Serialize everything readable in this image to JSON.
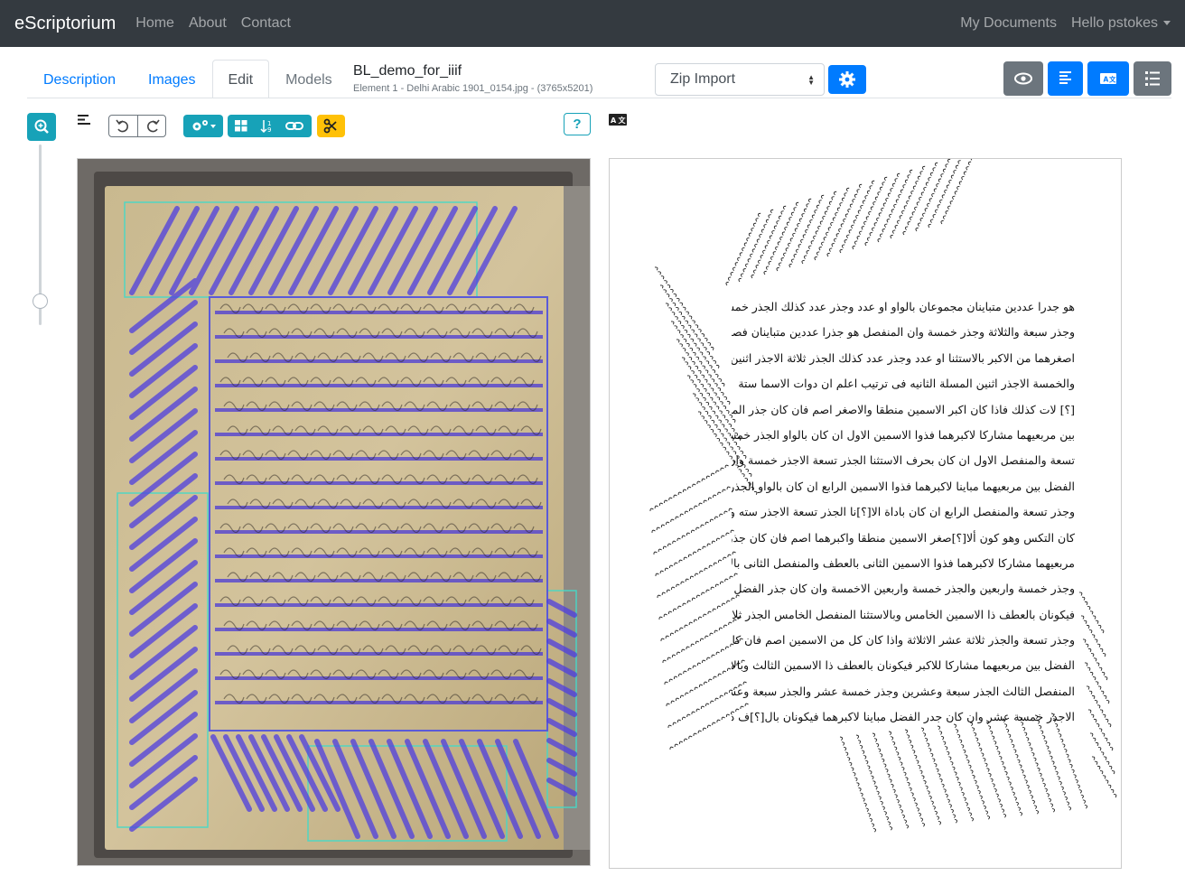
{
  "navbar": {
    "brand": "eScriptorium",
    "links": [
      "Home",
      "About",
      "Contact"
    ],
    "my_documents": "My Documents",
    "user_greeting": "Hello pstokes"
  },
  "tabs": [
    {
      "label": "Description",
      "state": "link"
    },
    {
      "label": "Images",
      "state": "link"
    },
    {
      "label": "Edit",
      "state": "active"
    },
    {
      "label": "Models",
      "state": "muted"
    }
  ],
  "document": {
    "title": "BL_demo_for_iiif",
    "subtitle": "Element 1 - Delhi Arabic 1901_0154.jpg - (3765x5201)"
  },
  "import_select": {
    "value": "Zip Import"
  },
  "toolbar": {
    "help_label": "?",
    "icons": [
      "zoom-in-icon",
      "text-direction-icon",
      "undo-icon",
      "redo-icon",
      "settings-dropdown-icon",
      "grid-icon",
      "sort-icon",
      "link-icon",
      "scissors-icon",
      "help-icon",
      "translate-icon",
      "eye-icon",
      "align-left-icon",
      "ocr-icon",
      "list-icon"
    ]
  },
  "colors": {
    "navbar": "#343a40",
    "primary": "#007bff",
    "info": "#17a2b8",
    "warning": "#ffc107",
    "secondary": "#6c757d"
  },
  "transcription": {
    "lines": [
      "هو جدرا عددين متباينان مجموعان بالواو او عدد وجذر عدد كذلك الجذر خمسة",
      "وجذر سبعة والثلاثة وجذر خمسة وان المنفصل هو جذرا عددين متباينان فصل",
      "اصغرهما من الاكبر بالاستثنا او عدد وجذر عدد كذلك الجذر ثلاثة الاجذر اثنين",
      "والخمسة الاجذر اثنين المسلة الثانيه فى ترتيب اعلم ان دوات الاسما ستة",
      "[؟] لات كذلك فاذا كان اكبر الاسمين منطقا والاصغر اصم فان كان جذر المنفصل",
      "بين مربعيهما مشاركا لاكبرهما فذوا الاسمين الاول ان كان بالواو الجذر خمسة وجذر",
      "تسعة والمنفصل الاول ان كان بحرف الاستثنا الجذر تسعة الاجذر خمسة وان كان جذر",
      "الفضل بين مربعيهما مباينا لاكبرهما فذوا الاسمين الرابع ان كان بالواو الجذر ستة",
      "وجذر تسعة والمنفصل الرابع ان كان باداة الا[؟]نا الجذر تسعة الاجذر سته واذا",
      "كان التكس وهو كون ألا[؟]صغر الاسمين منطقا واكبرهما اصم فان كان جذر الفضل بين",
      "مربعيهما مشاركا لاكبرهما فذوا الاسمين الثانى بالعطف والمنفصل الثانى بالاستثنا الخمسة",
      "وجذر خمسة واربعين والجذر خمسة واربعين الاخمسة وان كان جذر الفضل مباينا لاكبرهما",
      "فيكونان بالعطف ذا الاسمين الخامس وبالاستثنا المنفصل الخامس الجذر ثلاثة عشر",
      "وجذر تسعة والجذر ثلاثة عشر الاثلاثة واذا كان كل من الاسمين اصم فان كان جذر",
      "الفضل بين مربعيهما مشاركا للاكبر فيكونان بالعطف ذا الاسمين الثالث وبالاستثنا",
      "المنفصل الثالث الجذر سبعة وعشرين وجذر خمسة عشر والجذر سبعة وعشرين",
      "الاجذر خمسة عشر وان كان جدر الفضل مباينا لاكبرهما فيكونان بال[؟]ف ذا الاسمين"
    ]
  }
}
